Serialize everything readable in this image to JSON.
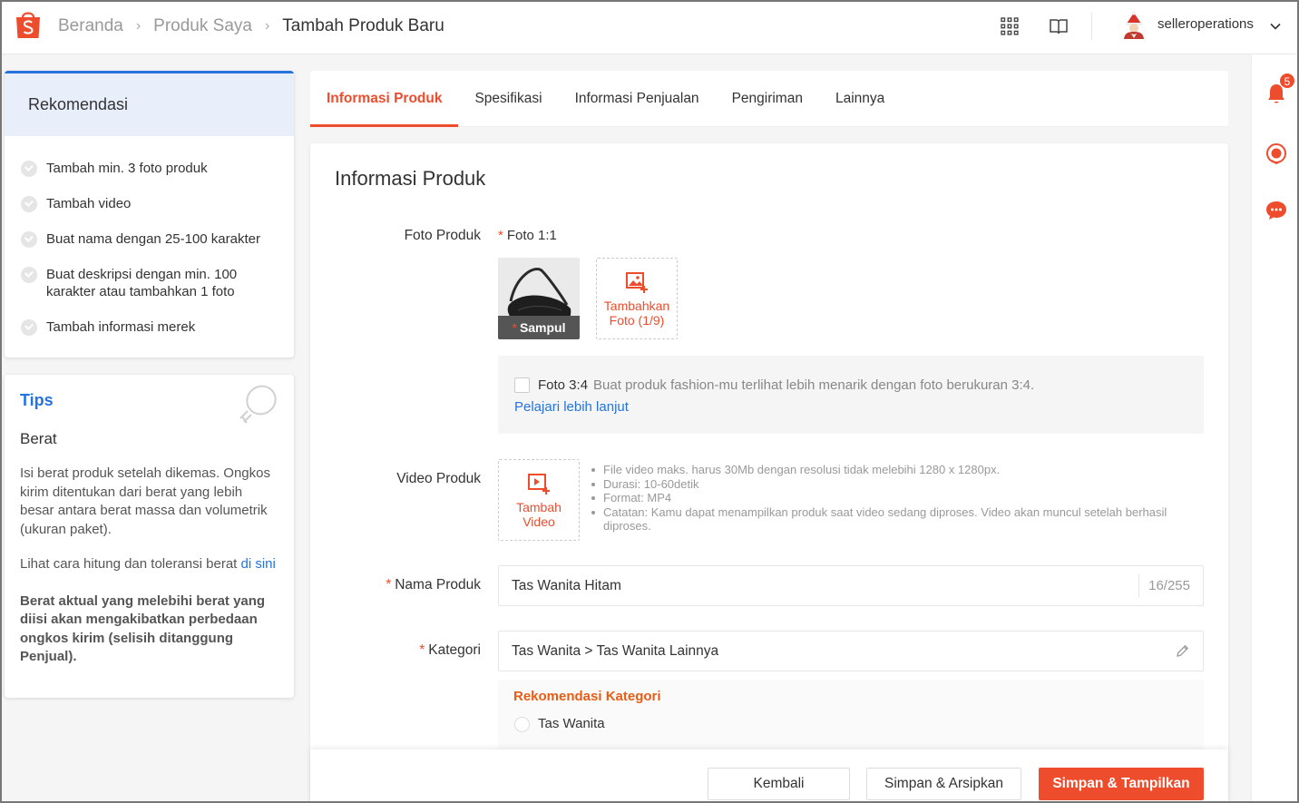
{
  "header": {
    "breadcrumb": [
      "Beranda",
      "Produk Saya",
      "Tambah Produk Baru"
    ],
    "username": "selleroperations"
  },
  "rail": {
    "notification_count": "5"
  },
  "sidebar": {
    "recommendation_title": "Rekomendasi",
    "recommendations": [
      "Tambah min. 3 foto produk",
      "Tambah video",
      "Buat nama dengan 25-100 karakter",
      "Buat deskripsi dengan min. 100 karakter atau tambahkan 1 foto",
      "Tambah informasi merek"
    ],
    "tips": {
      "title": "Tips",
      "subtitle": "Berat",
      "paragraph": "Isi berat produk setelah dikemas. Ongkos kirim ditentukan dari berat yang lebih besar antara berat massa dan volumetrik (ukuran paket).",
      "link_prefix": "Lihat cara hitung dan toleransi berat ",
      "link_text": "di sini",
      "warning": "Berat aktual yang melebihi berat yang diisi akan mengakibatkan perbedaan ongkos kirim (selisih ditanggung Penjual)."
    }
  },
  "tabs": [
    "Informasi Produk",
    "Spesifikasi",
    "Informasi Penjualan",
    "Pengiriman",
    "Lainnya"
  ],
  "form": {
    "title": "Informasi Produk",
    "photo_label": "Foto Produk",
    "photo_ratio_label": "Foto 1:1",
    "cover_label": "Sampul",
    "add_photo": "Tambahkan Foto (1/9)",
    "ratio34_label": "Foto 3:4",
    "ratio34_desc": "Buat produk fashion-mu terlihat lebih menarik dengan foto berukuran 3:4.",
    "learn_more": "Pelajari lebih lanjut",
    "video_label": "Video Produk",
    "add_video": "Tambah Video",
    "video_notes": [
      "File video maks. harus 30Mb dengan resolusi tidak melebihi 1280 x 1280px.",
      "Durasi: 10-60detik",
      "Format: MP4",
      "Catatan: Kamu dapat menampilkan produk saat video sedang diproses. Video akan muncul setelah berhasil diproses."
    ],
    "name_label": "Nama Produk",
    "name_value": "Tas Wanita Hitam",
    "name_counter": "16/255",
    "category_label": "Kategori",
    "category_value": "Tas Wanita > Tas Wanita Lainnya",
    "category_reco_title": "Rekomendasi Kategori",
    "category_reco_option": "Tas Wanita"
  },
  "footer": {
    "back": "Kembali",
    "save_archive": "Simpan & Arsipkan",
    "save_show": "Simpan & Tampilkan"
  },
  "colors": {
    "accent": "#ee4d2d",
    "link": "#2673dd"
  }
}
